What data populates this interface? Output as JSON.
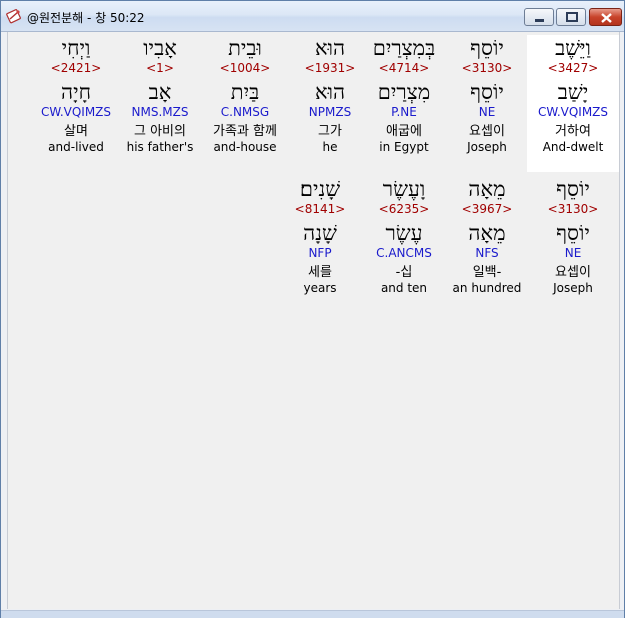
{
  "window": {
    "title": "@원전분해 - 창 50:22",
    "app_icon": "bible-app-icon",
    "controls": {
      "minimize": "minimize-icon",
      "maximize": "maximize-icon",
      "close": "close-icon"
    }
  },
  "colors": {
    "strong": "#a00000",
    "morph": "#1a1acc",
    "highlight": "#ffffff",
    "background": "#f0f0f0"
  },
  "lines": [
    {
      "words": [
        {
          "hebrew": "וַיֵּשֶׁב",
          "strong": "<3427>",
          "lemma": "יָשַׁב",
          "morph": "CW.VQIMZS",
          "korean": "거하여",
          "english": "And-dwelt",
          "highlighted": true
        },
        {
          "hebrew": "יוֹסֵף",
          "strong": "<3130>",
          "lemma": "יוֹסֵף",
          "morph": "NE",
          "korean": "요셉이",
          "english": "Joseph"
        },
        {
          "hebrew": "בְּמִצְרַיִם",
          "strong": "<4714>",
          "lemma": "מִצְרַיִם",
          "morph": "P.NE",
          "korean": "애굽에",
          "english": "in Egypt"
        },
        {
          "hebrew": "הוּא",
          "strong": "<1931>",
          "lemma": "הוּא",
          "morph": "NPMZS",
          "korean": "그가",
          "english": "he"
        },
        {
          "hebrew": "וּבֵית",
          "strong": "<1004>",
          "lemma": "בַּיִת",
          "morph": "C.NMSG",
          "korean": "가족과 함께",
          "english": "and-house"
        },
        {
          "hebrew": "אָבִיו",
          "strong": "<1>",
          "lemma": "אָב",
          "morph": "NMS.MZS",
          "korean": "그 아비의",
          "english": "his father's"
        },
        {
          "hebrew": "וַיְחִי",
          "strong": "<2421>",
          "lemma": "חָיָה",
          "morph": "CW.VQIMZS",
          "korean": "살며",
          "english": "and-lived"
        }
      ]
    },
    {
      "words": [
        {
          "hebrew": "יוֹסֵף",
          "strong": "<3130>",
          "lemma": "יוֹסֵף",
          "morph": "NE",
          "korean": "요셉이",
          "english": "Joseph"
        },
        {
          "hebrew": "מֵאָה",
          "strong": "<3967>",
          "lemma": "מֵאָה",
          "morph": "NFS",
          "korean": "일백-",
          "english": "an hundred"
        },
        {
          "hebrew": "וָעֶשֶׂר",
          "strong": "<6235>",
          "lemma": "עֶשֶׂר",
          "morph": "C.ANCMS",
          "korean": "-십",
          "english": "and ten"
        },
        {
          "hebrew": "שָׁנִים׃",
          "strong": "<8141>",
          "lemma": "שָׁנָה",
          "morph": "NFP",
          "korean": "세를",
          "english": "years"
        }
      ]
    }
  ]
}
